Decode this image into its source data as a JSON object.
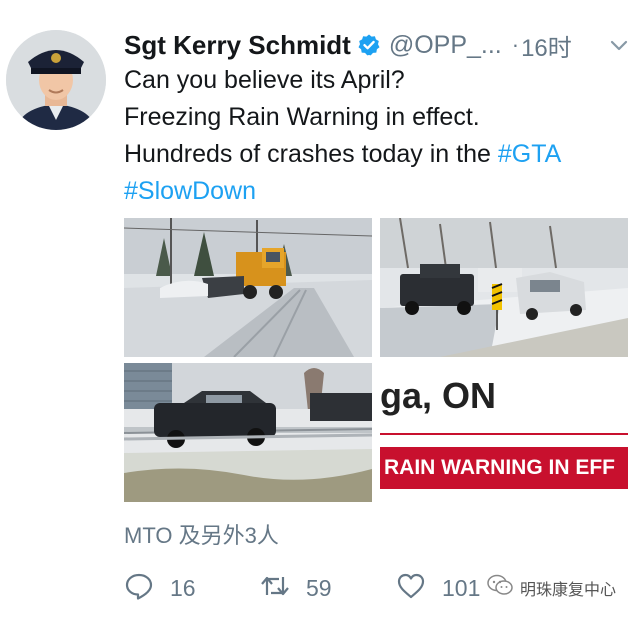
{
  "tweet": {
    "author_name": "Sgt Kerry Schmidt",
    "handle": "@OPP_...",
    "separator": "·",
    "time": "16时",
    "lines": [
      "Can you believe its April?",
      "Freezing Rain Warning in effect.",
      "Hundreds of crashes today in the"
    ],
    "hashtags": [
      "#GTA",
      "#SlowDown"
    ]
  },
  "media": {
    "news_location_text": "ga, ON",
    "news_banner_text": "RAIN WARNING IN EFF"
  },
  "retweeted_by": "MTO 及另外3人",
  "actions": {
    "reply_count": "16",
    "retweet_count": "59",
    "like_count": "101"
  },
  "watermark": "明珠康复中心",
  "colors": {
    "hashtag": "#1da1f2",
    "verified": "#1da1f2",
    "secondary_text": "#657786",
    "news_red": "#c8102e"
  },
  "icons": [
    "verified-badge-icon",
    "chevron-down-icon",
    "reply-icon",
    "retweet-icon",
    "like-icon",
    "wechat-icon"
  ]
}
